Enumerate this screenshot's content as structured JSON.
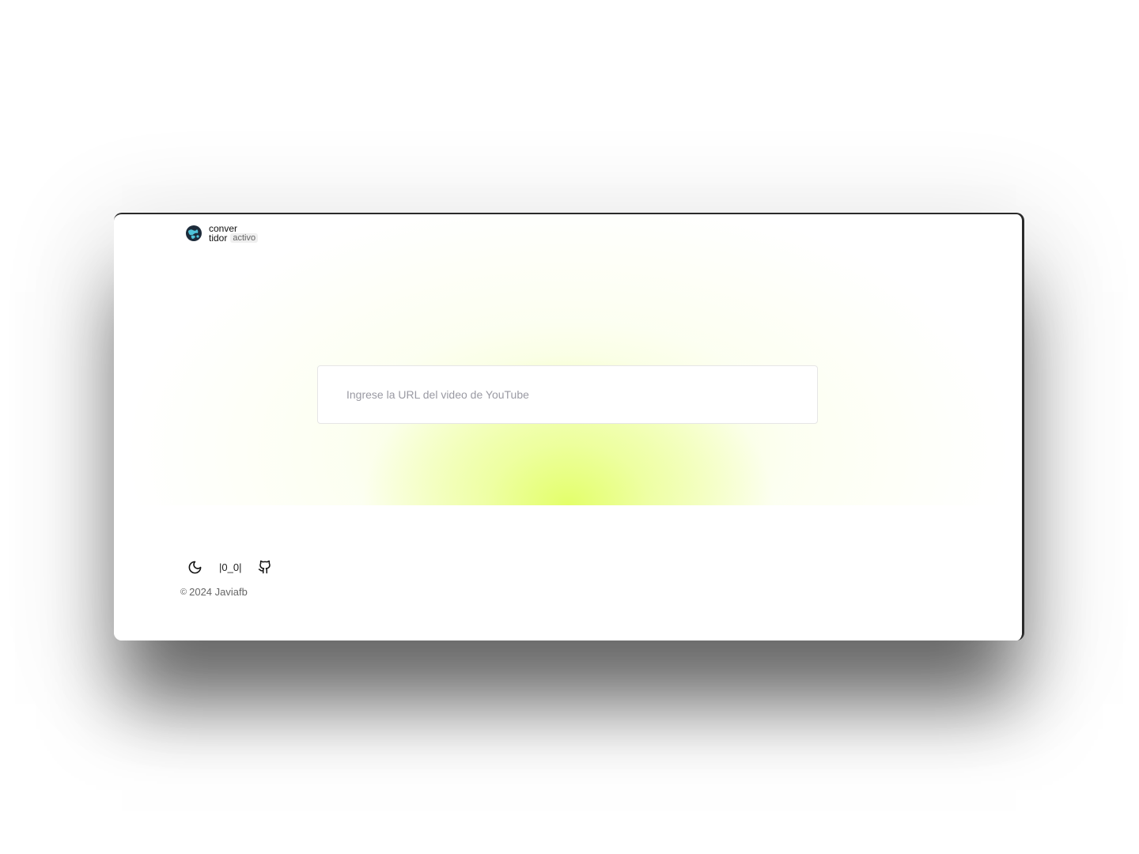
{
  "brand": {
    "line1": "conver",
    "line2": "tidor",
    "badge": "activo",
    "logo_icon": "globe-icon"
  },
  "converter": {
    "placeholder": "Ingrese la URL del video de YouTube",
    "value": ""
  },
  "footer": {
    "theme_icon": "moon-icon",
    "ascii_text": "|0_0|",
    "github_icon": "github-icon",
    "copyright_symbol": "©",
    "copyright_text": "2024 Javiafb"
  },
  "colors": {
    "glow": "#e6ff7a",
    "frame": "#2a2a2a",
    "placeholder": "#9a9aa3"
  }
}
